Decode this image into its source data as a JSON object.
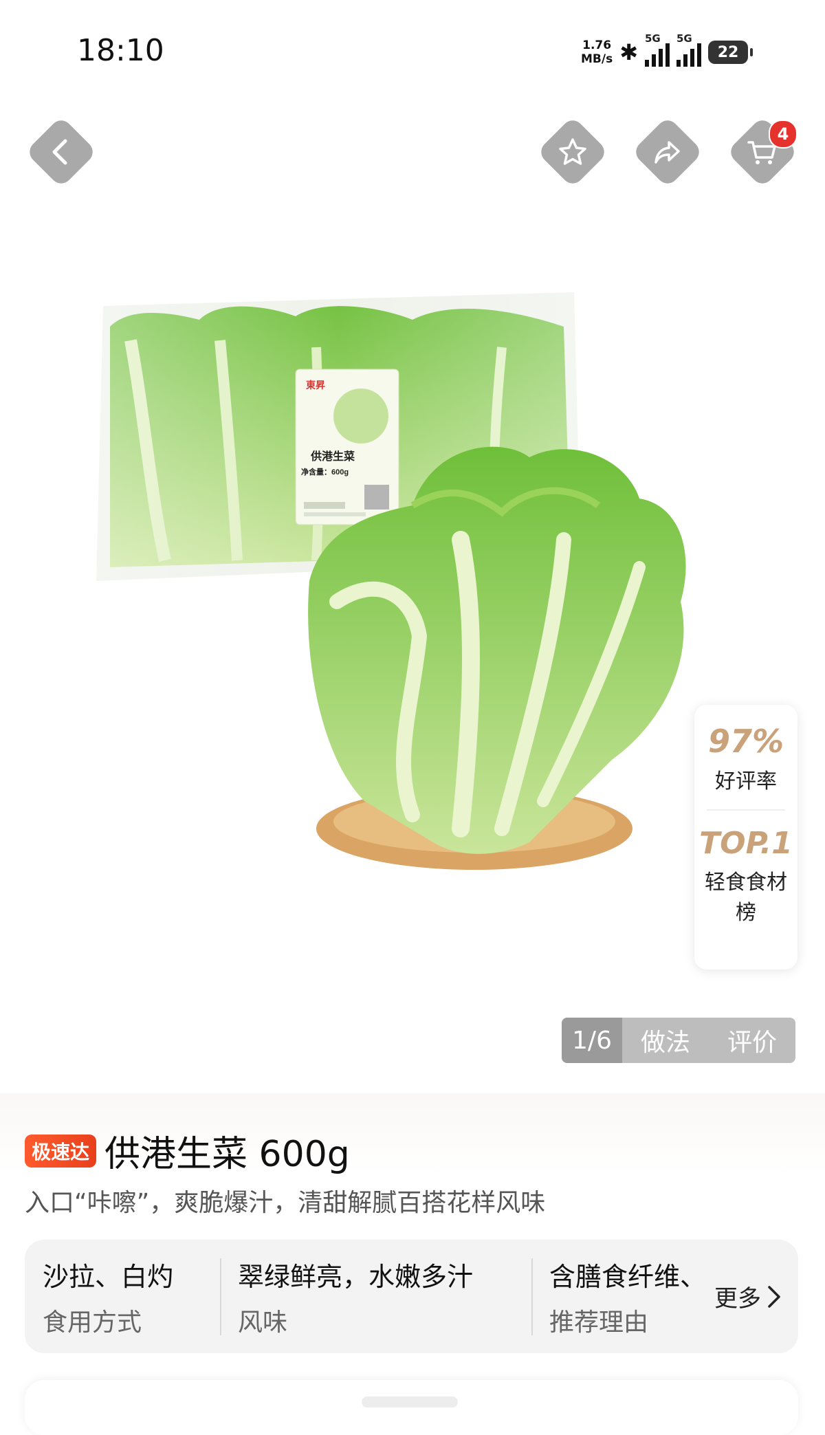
{
  "status_bar": {
    "time": "18:10",
    "net_speed_value": "1.76",
    "net_speed_unit": "MB/s",
    "signal1_label": "5G",
    "signal2_label": "5G",
    "battery": "22"
  },
  "nav": {
    "cart_badge": "4"
  },
  "rating_card": {
    "rating_value": "97%",
    "rating_label": "好评率",
    "rank_value": "TOP.1",
    "rank_label": "轻食食材榜"
  },
  "gallery": {
    "counter": "1/6",
    "tabs": [
      "做法",
      "评价"
    ]
  },
  "product": {
    "tag": "极速达",
    "title": "供港生菜 600g",
    "subtitle": "入口“咔嚓”，爽脆爆汁，清甜解腻百搭花样风味"
  },
  "package_label": {
    "brand": "東昇",
    "name": "供港生菜",
    "weight": "净含量：600g"
  },
  "attributes": [
    {
      "value": "沙拉、白灼",
      "label": "食用方式"
    },
    {
      "value": "翠绿鲜亮，水嫩多汁",
      "label": "风味"
    },
    {
      "value": "含膳食纤维、",
      "label": "推荐理由"
    }
  ],
  "more_label": "更多",
  "colors": {
    "accent_gold": "#c9a27a",
    "tag_red": "#e8401c",
    "badge_red": "#e5322d",
    "lettuce_green": "#7cc243"
  }
}
